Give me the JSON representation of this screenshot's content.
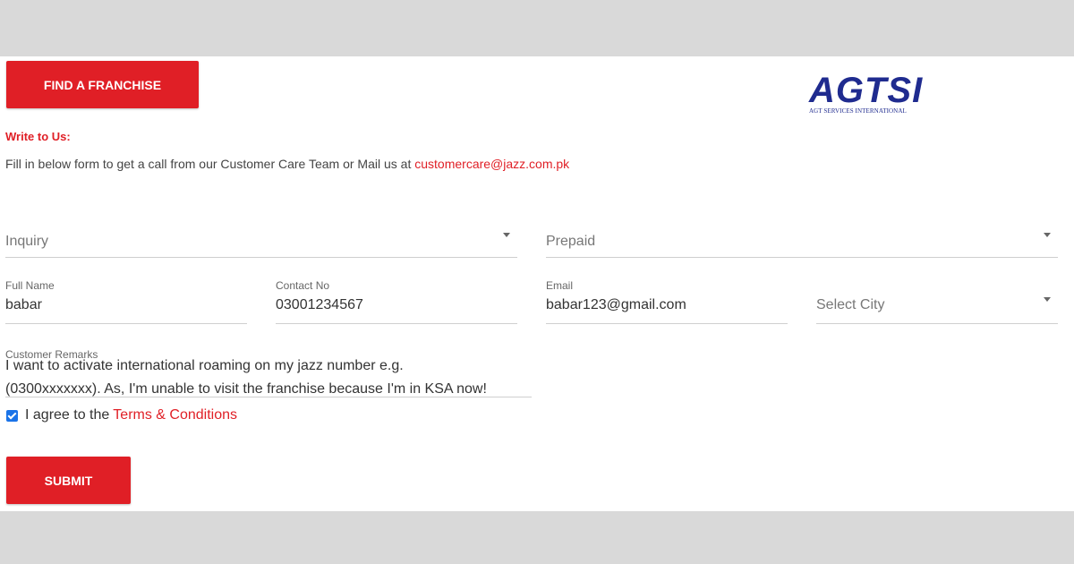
{
  "header": {
    "find_franchise_label": "FIND A FRANCHISE"
  },
  "logo": {
    "name": "AGTSI",
    "subtitle": "AGT SERVICES INTERNATIONAL"
  },
  "form": {
    "title": "Write to Us:",
    "intro_text": "Fill in below form to get a call from our Customer Care Team or Mail us at ",
    "intro_email": "customercare@jazz.com.pk",
    "inquiry_type": {
      "value": "Inquiry"
    },
    "connection_type": {
      "value": "Prepaid"
    },
    "full_name": {
      "label": "Full Name",
      "value": "babar"
    },
    "contact_no": {
      "label": "Contact No",
      "value": "03001234567"
    },
    "email": {
      "label": "Email",
      "value": "babar123@gmail.com"
    },
    "city": {
      "placeholder": "Select City"
    },
    "remarks": {
      "label": "Customer Remarks",
      "line1": "I want to activate international roaming on my jazz number e.g.",
      "line2": "(0300xxxxxxx). As, I'm unable to visit the franchise because I'm in KSA now!"
    },
    "agree_text": "I agree to the",
    "terms_link": "Terms & Conditions",
    "agree_checked": true,
    "submit_label": "SUBMIT"
  },
  "colors": {
    "accent": "#e01f26",
    "logo_blue": "#1f2b8f",
    "checkbox": "#1a73e8"
  }
}
